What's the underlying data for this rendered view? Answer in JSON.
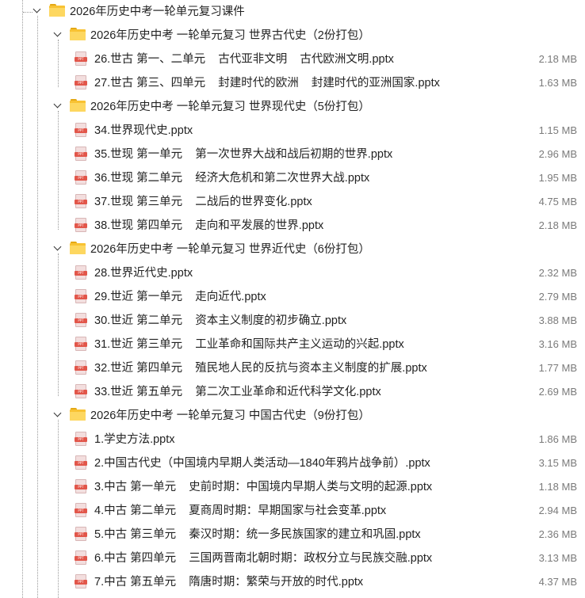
{
  "root": {
    "label": "2026年历史中考一轮单元复习课件"
  },
  "folders": [
    {
      "label": "2026年历史中考 一轮单元复习 世界古代史（2份打包）",
      "files": [
        {
          "name": "26.世古 第一、二单元    古代亚非文明    古代欧洲文明.pptx",
          "size": "2.18 MB"
        },
        {
          "name": "27.世古 第三、四单元    封建时代的欧洲    封建时代的亚洲国家.pptx",
          "size": "1.63 MB"
        }
      ]
    },
    {
      "label": "2026年历史中考 一轮单元复习 世界现代史（5份打包）",
      "files": [
        {
          "name": "34.世界现代史.pptx",
          "size": "1.15 MB"
        },
        {
          "name": "35.世现 第一单元    第一次世界大战和战后初期的世界.pptx",
          "size": "2.96 MB"
        },
        {
          "name": "36.世现 第二单元    经济大危机和第二次世界大战.pptx",
          "size": "1.95 MB"
        },
        {
          "name": "37.世现 第三单元    二战后的世界变化.pptx",
          "size": "4.75 MB"
        },
        {
          "name": "38.世现 第四单元    走向和平发展的世界.pptx",
          "size": "2.18 MB"
        }
      ]
    },
    {
      "label": "2026年历史中考 一轮单元复习 世界近代史（6份打包）",
      "files": [
        {
          "name": "28.世界近代史.pptx",
          "size": "2.32 MB"
        },
        {
          "name": "29.世近 第一单元    走向近代.pptx",
          "size": "2.79 MB"
        },
        {
          "name": "30.世近 第二单元    资本主义制度的初步确立.pptx",
          "size": "3.88 MB"
        },
        {
          "name": "31.世近 第三单元    工业革命和国际共产主义运动的兴起.pptx",
          "size": "3.16 MB"
        },
        {
          "name": "32.世近 第四单元    殖民地人民的反抗与资本主义制度的扩展.pptx",
          "size": "1.77 MB"
        },
        {
          "name": "33.世近 第五单元    第二次工业革命和近代科学文化.pptx",
          "size": "2.69 MB"
        }
      ]
    },
    {
      "label": "2026年历史中考 一轮单元复习 中国古代史（9份打包）",
      "files": [
        {
          "name": "1.学史方法.pptx",
          "size": "1.86 MB"
        },
        {
          "name": "2.中国古代史（中国境内早期人类活动—1840年鸦片战争前）.pptx",
          "size": "3.15 MB"
        },
        {
          "name": "3.中古 第一单元    史前时期：中国境内早期人类与文明的起源.pptx",
          "size": "1.18 MB"
        },
        {
          "name": "4.中古 第二单元    夏商周时期：早期国家与社会变革.pptx",
          "size": "2.94 MB"
        },
        {
          "name": "5.中古 第三单元    秦汉时期：统一多民族国家的建立和巩固.pptx",
          "size": "2.36 MB"
        },
        {
          "name": "6.中古 第四单元    三国两晋南北朝时期：政权分立与民族交融.pptx",
          "size": "3.13 MB"
        },
        {
          "name": "7.中古 第五单元    隋唐时期：繁荣与开放的时代.pptx",
          "size": "4.37 MB"
        }
      ]
    }
  ],
  "icons": {
    "folder": "folder-icon",
    "file": "pptx-file-icon",
    "expand": "chevron-down-icon"
  },
  "colors": {
    "folder": "#f8c233",
    "pptx": "#e2564a",
    "size_text": "#7a7a7a",
    "tree_line": "#9a9a9a"
  }
}
